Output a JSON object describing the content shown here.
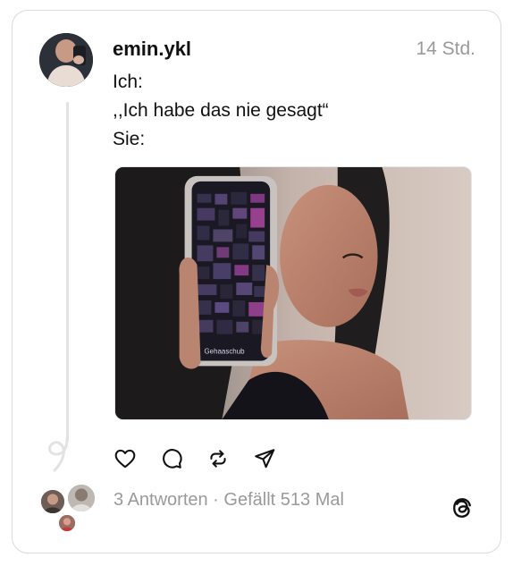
{
  "post": {
    "username": "emin.ykl",
    "timestamp": "14 Std.",
    "lines": [
      "Ich:",
      ",,Ich habe das nie gesagt“",
      "Sie:"
    ],
    "media_phone_label": "Gehaaschub"
  },
  "actions": {
    "like_icon": "heart-icon",
    "reply_icon": "comment-icon",
    "repost_icon": "repost-icon",
    "share_icon": "send-icon"
  },
  "stats": {
    "replies": "3 Antworten",
    "separator": " · ",
    "likes": "Gefällt 513 Mal"
  },
  "colors": {
    "text": "#111111",
    "muted": "#9a9a9a",
    "border": "#dbdbdb"
  }
}
